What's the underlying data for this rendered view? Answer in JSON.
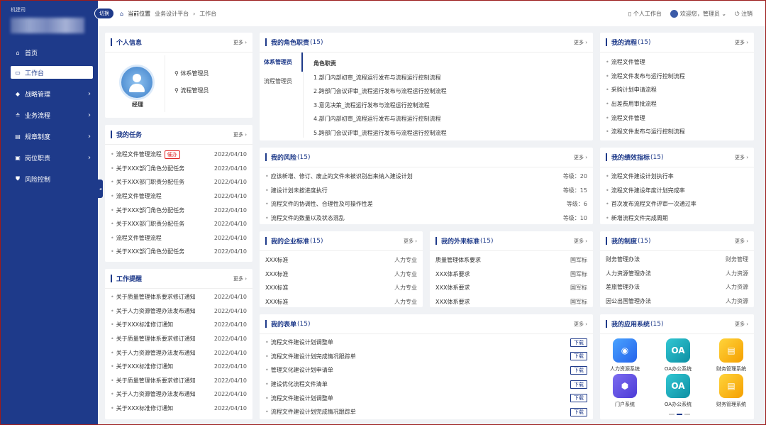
{
  "sidebar": {
    "logo_small": "机建司",
    "items": [
      {
        "icon": "home-icon",
        "glyph": "⌂",
        "label": "首页"
      },
      {
        "icon": "workbench-icon",
        "glyph": "▭",
        "label": "工作台"
      },
      {
        "icon": "strategy-icon",
        "glyph": "◆",
        "label": "战略管理"
      },
      {
        "icon": "process-icon",
        "glyph": "≗",
        "label": "业务流程"
      },
      {
        "icon": "rules-icon",
        "glyph": "▤",
        "label": "规章制度"
      },
      {
        "icon": "post-icon",
        "glyph": "▣",
        "label": "岗位职责"
      },
      {
        "icon": "shield-icon",
        "glyph": "⛊",
        "label": "风险控制"
      }
    ]
  },
  "topbar": {
    "switch": "切换",
    "crumbs": [
      "当前位置",
      "业务设计平台",
      "工作台"
    ],
    "personal": "个人工作台",
    "welcome": "欢迎您，管理员",
    "logout": "注销"
  },
  "more": "更多",
  "personal": {
    "title": "个人信息",
    "name": "经理",
    "roles": [
      "体系管理员",
      "流程管理员"
    ]
  },
  "roles": {
    "title": "我的角色职责",
    "count": "(15)",
    "tabs": [
      "体系管理员",
      "流程管理员"
    ],
    "header": "角色职责",
    "items": [
      "1.部门内部初审_流程运行发布与流程运行控制流程",
      "2.跨部门会议评审_流程运行发布与流程运行控制流程",
      "3.意见决策_流程运行发布与流程运行控制流程",
      "4.部门内部初审_流程运行发布与流程运行控制流程",
      "5.跨部门会议评审_流程运行发布与流程运行控制流程"
    ]
  },
  "myprocess": {
    "title": "我的流程",
    "count": "(15)",
    "items": [
      "流程文件管理",
      "流程文件发布与运行控制流程",
      "采购计划申请流程",
      "出差费用审批流程",
      "流程文件管理",
      "流程文件发布与运行控制流程"
    ]
  },
  "tasks": {
    "title": "我的任务",
    "urge": "催办",
    "items": [
      {
        "text": "流程文件管理流程",
        "date": "2022/04/10"
      },
      {
        "text": "关于XXX部门角色分配任务",
        "date": "2022/04/10"
      },
      {
        "text": "关于XXX部门职责分配任务",
        "date": "2022/04/10"
      },
      {
        "text": "流程文件管理流程",
        "date": "2022/04/10"
      },
      {
        "text": "关于XXX部门角色分配任务",
        "date": "2022/04/10"
      },
      {
        "text": "关于XXX部门职责分配任务",
        "date": "2022/04/10"
      },
      {
        "text": "流程文件管理流程",
        "date": "2022/04/10"
      },
      {
        "text": "关于XXX部门角色分配任务",
        "date": "2022/04/10"
      }
    ]
  },
  "risks": {
    "title": "我的风险",
    "count": "(15)",
    "items": [
      {
        "text": "应该新增、修订、废止的文件未被识别出来纳入建设计划",
        "level": "等级：20"
      },
      {
        "text": "建设计划未按进度执行",
        "level": "等级：15"
      },
      {
        "text": "流程文件的协调性、合理性及可操作性差",
        "level": "等级：6"
      },
      {
        "text": "流程文件的数量以及状态混乱",
        "level": "等级：10"
      }
    ]
  },
  "kpi": {
    "title": "我的绩效指标",
    "count": "(15)",
    "items": [
      "流程文件建设计划执行率",
      "流程文件建设年度计划完成率",
      "首次发布流程文件评审一次通过率",
      "新增流程文件完成周期"
    ]
  },
  "reminders": {
    "title": "工作提醒",
    "items": [
      {
        "text": "关于质量管理体系要求修订通知",
        "date": "2022/04/10"
      },
      {
        "text": "关于人力资源管理办法发布通知",
        "date": "2022/04/10"
      },
      {
        "text": "关于XXX标准修订通知",
        "date": "2022/04/10"
      },
      {
        "text": "关于质量管理体系要求修订通知",
        "date": "2022/04/10"
      },
      {
        "text": "关于人力资源管理办法发布通知",
        "date": "2022/04/10"
      },
      {
        "text": "关于XXX标准修订通知",
        "date": "2022/04/10"
      },
      {
        "text": "关于质量管理体系要求修订通知",
        "date": "2022/04/10"
      },
      {
        "text": "关于人力资源管理办法发布通知",
        "date": "2022/04/10"
      },
      {
        "text": "关于XXX标准修订通知",
        "date": "2022/04/10"
      }
    ]
  },
  "ent_std": {
    "title": "我的企业标准",
    "count": "(15)",
    "items": [
      {
        "name": "XXX标准",
        "cat": "人力专业"
      },
      {
        "name": "XXX标准",
        "cat": "人力专业"
      },
      {
        "name": "XXX标准",
        "cat": "人力专业"
      },
      {
        "name": "XXX标准",
        "cat": "人力专业"
      }
    ]
  },
  "ext_std": {
    "title": "我的外来标准",
    "count": "(15)",
    "items": [
      {
        "name": "质量管理体系要求",
        "cat": "国军标"
      },
      {
        "name": "XXX体系要求",
        "cat": "国军标"
      },
      {
        "name": "XXX体系要求",
        "cat": "国军标"
      },
      {
        "name": "XXX体系要求",
        "cat": "国军标"
      }
    ]
  },
  "systems": {
    "title": "我的制度",
    "count": "(15)",
    "items": [
      {
        "name": "财务管理办法",
        "cat": "财务管理"
      },
      {
        "name": "人力资源管理办法",
        "cat": "人力资源"
      },
      {
        "name": "差旅管理办法",
        "cat": "人力资源"
      },
      {
        "name": "因公出国管理办法",
        "cat": "人力资源"
      }
    ]
  },
  "forms": {
    "title": "我的表单",
    "count": "(15)",
    "download": "下载",
    "items": [
      "流程文件建设计划调整单",
      "流程文件建设计划完成情况跟踪单",
      "管理文化建设计划申请单",
      "建设优化流程文件清单",
      "流程文件建设计划调整单",
      "流程文件建设计划完成情况跟踪单"
    ]
  },
  "apps": {
    "title": "我的应用系统",
    "count": "(15)",
    "items": [
      {
        "label": "人力资源系统",
        "icon": "people-icon",
        "glyph": "👥",
        "style": "ic-blue"
      },
      {
        "label": "OA办公系统",
        "icon": "oa-icon",
        "glyph": "OA",
        "style": "ic-teal"
      },
      {
        "label": "财务管理系统",
        "icon": "finance-icon",
        "glyph": "▤",
        "style": "ic-yellow"
      },
      {
        "label": "门户系统",
        "icon": "portal-icon",
        "glyph": "⬢",
        "style": "ic-purple"
      },
      {
        "label": "OA办公系统",
        "icon": "oa-icon",
        "glyph": "OA",
        "style": "ic-teal"
      },
      {
        "label": "财务管理系统",
        "icon": "finance-icon",
        "glyph": "▤",
        "style": "ic-yellow"
      }
    ]
  }
}
